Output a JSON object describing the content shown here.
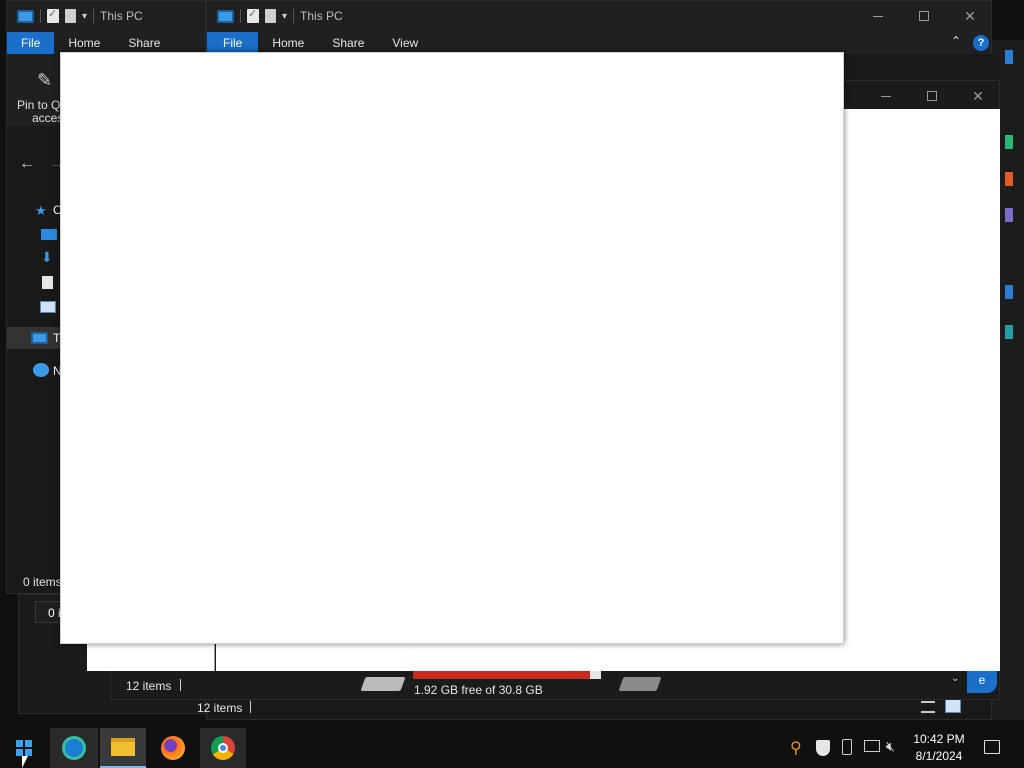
{
  "back_window": {
    "title": "This PC",
    "ribbon": {
      "file": "File",
      "home": "Home",
      "share": "Share"
    },
    "pin_label_line1": "Pin to Qu",
    "pin_label_line2": "access",
    "nav": {
      "quick": "C",
      "this_pc": "T",
      "network": "N"
    },
    "status": "0 items",
    "status2": "0 i"
  },
  "front_window": {
    "title": "This PC",
    "ribbon": {
      "file": "File",
      "home": "Home",
      "share": "Share",
      "view": "View"
    },
    "help": "?",
    "status_items": "12 items",
    "status_items_inner": "12 items",
    "drive_free": "1.92 GB free of 30.8 GB",
    "drive_fill_percent": 94,
    "edge_letter": "e"
  },
  "taskbar": {
    "time": "10:42 PM",
    "date": "8/1/2024",
    "apps": [
      "Microsoft Edge",
      "File Explorer",
      "Firefox",
      "Google Chrome"
    ]
  },
  "colors": {
    "accent": "#1a6fc8",
    "drive_bar": "#c42b1c",
    "window_bg": "#191919"
  }
}
